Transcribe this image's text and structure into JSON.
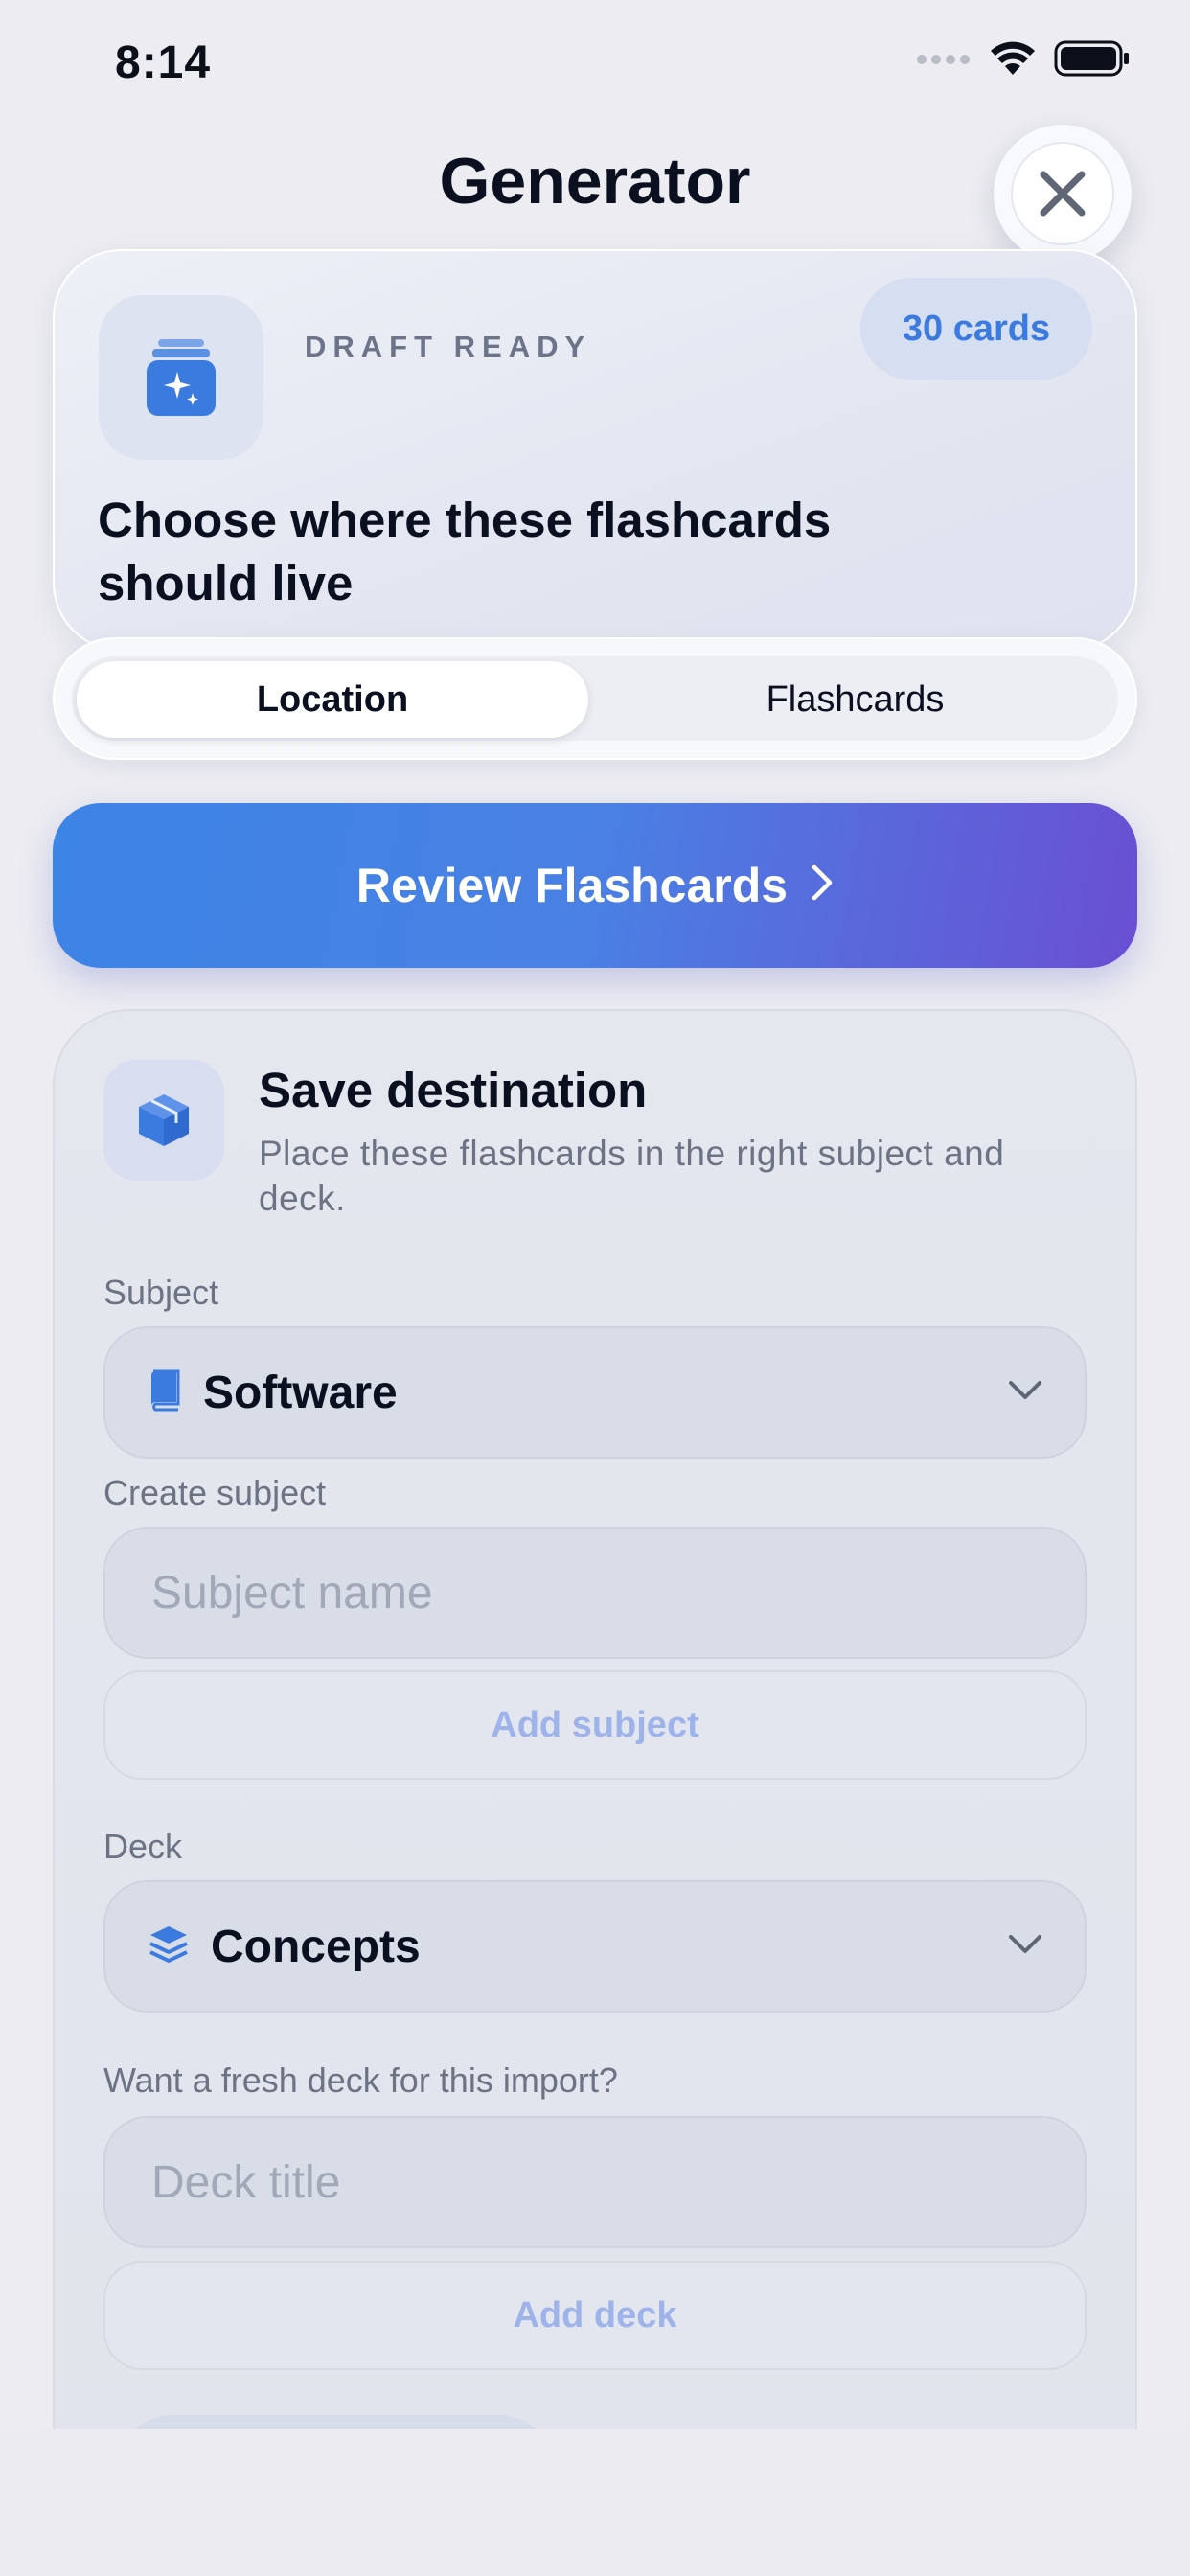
{
  "status_bar": {
    "time": "8:14"
  },
  "header": {
    "title": "Generator",
    "close_icon": "close-x-icon"
  },
  "draft": {
    "label": "DRAFT READY",
    "badge": "30 cards",
    "heading": "Choose where these flashcards should live",
    "icon": "sparkle-stack-icon"
  },
  "tabs": [
    {
      "label": "Location",
      "active": true
    },
    {
      "label": "Flashcards",
      "active": false
    }
  ],
  "review_button": {
    "label": "Review Flashcards",
    "icon": "chevron-right-icon"
  },
  "destination": {
    "title": "Save destination",
    "description": "Place these flashcards in the right subject and deck.",
    "icon": "cube-icon",
    "subject_label": "Subject",
    "subject_value": "Software",
    "subject_icon": "book-icon",
    "create_subject_label": "Create subject",
    "subject_placeholder": "Subject name",
    "add_subject_label": "Add subject",
    "deck_label": "Deck",
    "deck_value": "Concepts",
    "deck_icon": "layers-icon",
    "fresh_deck_label": "Want a fresh deck for this import?",
    "deck_placeholder": "Deck title",
    "add_deck_label": "Add deck"
  },
  "colors": {
    "accent": "#3b7be0",
    "gradient_start": "#3c84e6",
    "gradient_end": "#6a4fd3",
    "background": "#ececf1"
  }
}
